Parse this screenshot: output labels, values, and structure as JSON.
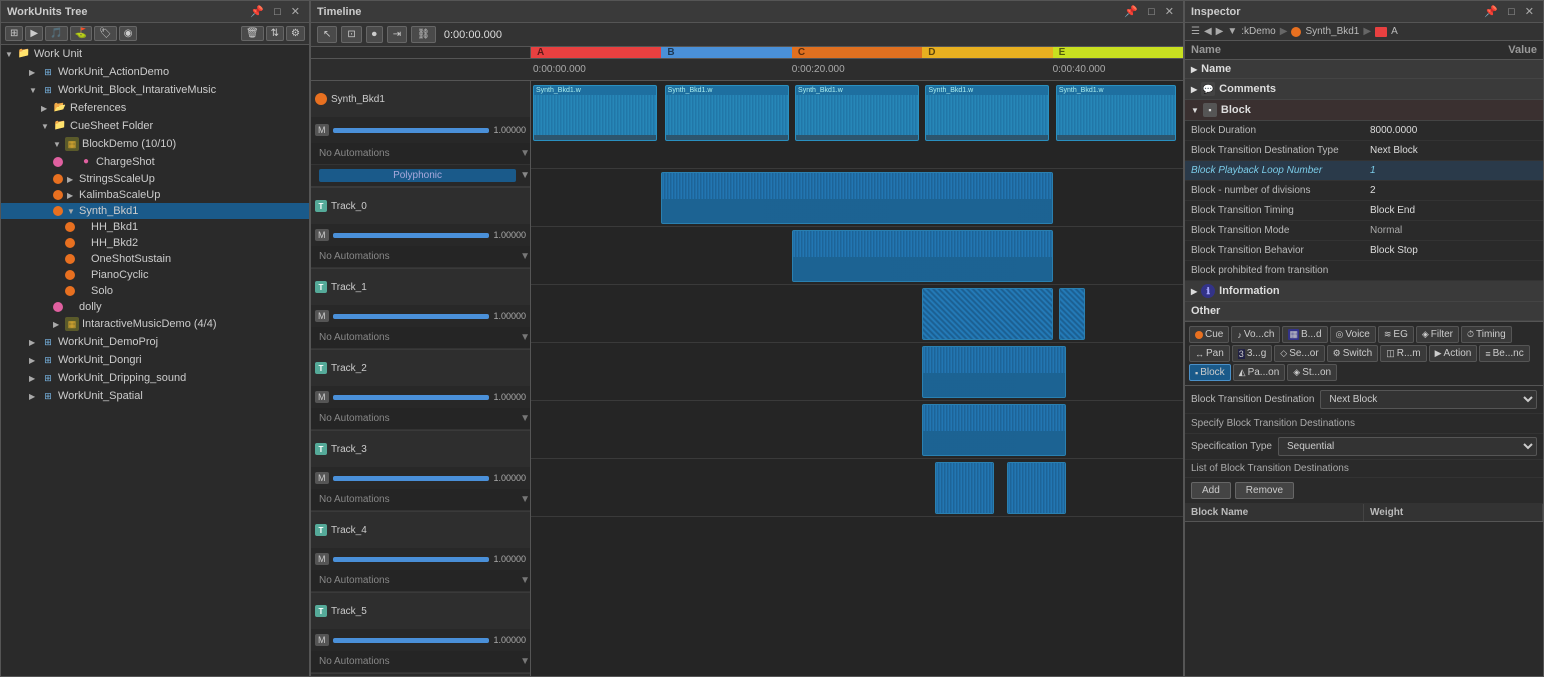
{
  "workunits_tree": {
    "title": "WorkUnits Tree",
    "items": [
      {
        "id": "wu-root",
        "label": "Work Unit",
        "indent": 0,
        "type": "folder",
        "expanded": true
      },
      {
        "id": "wu-action",
        "label": "WorkUnit_ActionDemo",
        "indent": 1,
        "type": "wu"
      },
      {
        "id": "wu-block",
        "label": "WorkUnit_Block_IntarativeMusic",
        "indent": 1,
        "type": "wu",
        "expanded": true
      },
      {
        "id": "refs",
        "label": "References",
        "indent": 2,
        "type": "folder"
      },
      {
        "id": "cuesheet",
        "label": "CueSheet Folder",
        "indent": 2,
        "type": "folder",
        "expanded": true
      },
      {
        "id": "blockdemo",
        "label": "BlockDemo (10/10)",
        "indent": 3,
        "type": "wu",
        "expanded": true
      },
      {
        "id": "chargeshot",
        "label": "ChargeShot",
        "indent": 4,
        "type": "item",
        "color": "pink"
      },
      {
        "id": "stringsscaleup",
        "label": "StringsScaleUp",
        "indent": 4,
        "type": "item",
        "color": "orange"
      },
      {
        "id": "kalimbascaleup",
        "label": "KalimbaScaleUp",
        "indent": 4,
        "type": "item",
        "color": "orange"
      },
      {
        "id": "synth_bkd1",
        "label": "Synth_Bkd1",
        "indent": 4,
        "type": "item",
        "color": "orange",
        "selected": true
      },
      {
        "id": "hh_bkd1",
        "label": "HH_Bkd1",
        "indent": 5,
        "type": "item",
        "color": "orange"
      },
      {
        "id": "hh_bkd2",
        "label": "HH_Bkd2",
        "indent": 5,
        "type": "item",
        "color": "orange"
      },
      {
        "id": "oneshotsustain",
        "label": "OneShotSustain",
        "indent": 5,
        "type": "item",
        "color": "orange"
      },
      {
        "id": "pianocyclic",
        "label": "PianoCyclic",
        "indent": 5,
        "type": "item",
        "color": "orange"
      },
      {
        "id": "solo",
        "label": "Solo",
        "indent": 5,
        "type": "item",
        "color": "orange"
      },
      {
        "id": "dolly",
        "label": "dolly",
        "indent": 4,
        "type": "item",
        "color": "pink"
      },
      {
        "id": "intaractivemusicdemo",
        "label": "IntaractiveMusicDemo (4/4)",
        "indent": 3,
        "type": "wu"
      },
      {
        "id": "wu-demoproj",
        "label": "WorkUnit_DemoProj",
        "indent": 1,
        "type": "wu"
      },
      {
        "id": "wu-dongri",
        "label": "WorkUnit_Dongri",
        "indent": 1,
        "type": "wu"
      },
      {
        "id": "wu-dripping",
        "label": "WorkUnit_Dripping_sound",
        "indent": 1,
        "type": "wu"
      },
      {
        "id": "wu-spatial",
        "label": "WorkUnit_Spatial",
        "indent": 1,
        "type": "wu"
      }
    ]
  },
  "timeline": {
    "title": "Timeline",
    "time_markers": [
      "0:00:00.000",
      "0:00:20.000",
      "0:00:40.000"
    ],
    "color_blocks": [
      {
        "label": "A",
        "color": "#e84040"
      },
      {
        "label": "B",
        "color": "#4a90d8"
      },
      {
        "label": "C",
        "color": "#e07020"
      },
      {
        "label": "D",
        "color": "#e8b020"
      },
      {
        "label": "E",
        "color": "#c8e020"
      }
    ],
    "tracks": [
      {
        "name": "Synth_Bkd1",
        "type": "main",
        "volume": "1.00000",
        "automation": "No Automations"
      },
      {
        "name": "Track_0",
        "type": "T",
        "volume": "1.00000",
        "automation": "No Automations"
      },
      {
        "name": "Track_1",
        "type": "T",
        "volume": "1.00000",
        "automation": "No Automations"
      },
      {
        "name": "Track_2",
        "type": "T",
        "volume": "1.00000",
        "automation": "No Automations"
      },
      {
        "name": "Track_3",
        "type": "T",
        "volume": "1.00000",
        "automation": "No Automations"
      },
      {
        "name": "Track_4",
        "type": "T",
        "volume": "1.00000",
        "automation": "No Automations"
      },
      {
        "name": "Track_5",
        "type": "T",
        "volume": "1.00000",
        "automation": "No Automations"
      }
    ]
  },
  "inspector": {
    "title": "Inspector",
    "breadcrumb": [
      ":kDemo",
      "Synth_Bkd1",
      "A"
    ],
    "header": {
      "name": "Name",
      "value": "Value"
    },
    "sections": [
      {
        "label": "Name",
        "type": "section"
      },
      {
        "label": "Comments",
        "type": "section"
      },
      {
        "label": "Block",
        "type": "section",
        "expanded": true,
        "props": [
          {
            "name": "Block Duration",
            "value": "8000.0000",
            "highlighted": false
          },
          {
            "name": "Block Transition Destination Type",
            "value": "Next Block",
            "highlighted": false
          },
          {
            "name": "Block Playback Loop Number",
            "value": "1",
            "highlighted": true
          },
          {
            "name": "Block - number of divisions",
            "value": "2",
            "highlighted": false
          },
          {
            "name": "Block Transition Timing",
            "value": "Block End",
            "highlighted": false
          },
          {
            "name": "Block Transition Mode",
            "value": "Normal",
            "highlighted": false
          },
          {
            "name": "Block Transition Behavior",
            "value": "Block Stop",
            "highlighted": false
          },
          {
            "name": "Block prohibited from transition",
            "value": "",
            "highlighted": false
          }
        ]
      },
      {
        "label": "Information",
        "type": "section"
      },
      {
        "label": "Other",
        "type": "section"
      }
    ],
    "tabs": [
      {
        "label": "Cue",
        "icon": "●",
        "active": false
      },
      {
        "label": "Vo...ch",
        "icon": "♪",
        "active": false
      },
      {
        "label": "B...d",
        "icon": "▦",
        "active": false
      },
      {
        "label": "Voice",
        "icon": "◎",
        "active": false
      },
      {
        "label": "EG",
        "icon": "≋",
        "active": false
      },
      {
        "label": "Filter",
        "icon": "◈",
        "active": false
      },
      {
        "label": "Timing",
        "icon": "⏱",
        "active": false
      },
      {
        "label": "Pan",
        "icon": "↔",
        "active": false
      },
      {
        "label": "3...g",
        "icon": "3",
        "active": false
      },
      {
        "label": "Se...or",
        "icon": "◇",
        "active": false
      },
      {
        "label": "Switch",
        "icon": "⚙",
        "active": false
      },
      {
        "label": "R...m",
        "icon": "◫",
        "active": false
      },
      {
        "label": "Action",
        "icon": "▶",
        "active": false
      },
      {
        "label": "Be...nc",
        "icon": "≡",
        "active": false
      },
      {
        "label": "Block",
        "icon": "▪",
        "active": true
      },
      {
        "label": "Pa...on",
        "icon": "◭",
        "active": false
      },
      {
        "label": "St...on",
        "icon": "◈",
        "active": false
      }
    ],
    "block_transition_destination": {
      "label": "Block Transition Destination",
      "value": "Next Block"
    },
    "specify_header": "Specify Block Transition Destinations",
    "specification_type": {
      "label": "Specification Type",
      "value": "Sequential"
    },
    "list_header": "List of Block Transition Destinations",
    "add_label": "Add",
    "remove_label": "Remove",
    "table_cols": [
      "Block Name",
      "Weight"
    ]
  }
}
